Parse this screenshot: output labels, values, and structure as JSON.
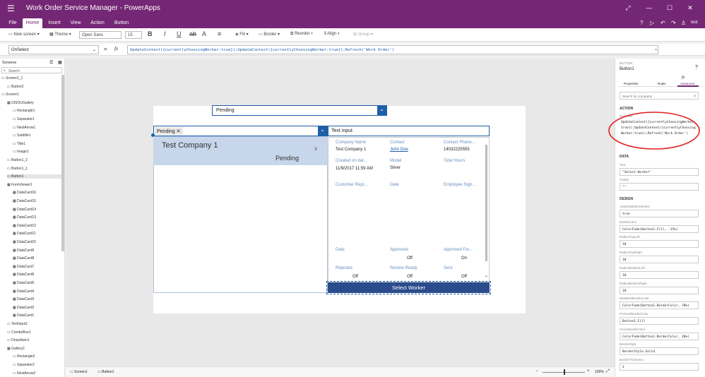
{
  "app": {
    "title": "Work Order Service Manager - PowerApps",
    "user": "test"
  },
  "tabs": [
    "File",
    "Home",
    "Insert",
    "View",
    "Action",
    "Button"
  ],
  "ribbon": {
    "new_screen": "New screen",
    "theme": "Theme",
    "font": "Open Sans",
    "font_size": "15",
    "fill": "Fill",
    "border": "Border",
    "reorder": "Reorder",
    "align": "Align",
    "group": "Group"
  },
  "formula_bar": {
    "property": "OnSelect",
    "fx": "fx",
    "formula": "UpdateContext({currentlyChoosingWorker:true});UpdateContext({currentlyChoosingWorker:true});Refresh('Work Order')"
  },
  "tree": {
    "header": "Screens",
    "search_placeholder": "Search",
    "items": [
      "Screen1_1",
      "Button2",
      "Screen1",
      "DISOUGallery",
      "Rectangle1",
      "Separator1",
      "NextArrow1",
      "Subtitle1",
      "Title1",
      "Image1",
      "Button1_2",
      "Button1_1",
      "Button1",
      "FormViewer1",
      "DataCard16",
      "DataCard15",
      "DataCard14",
      "DataCard13",
      "DataCard12",
      "DataCard11",
      "DataCard10",
      "DataCard9",
      "DataCard8",
      "DataCard7",
      "DataCard6",
      "DataCard5",
      "DataCard4",
      "DataCard3",
      "DataCard2",
      "DataCard1",
      "TextInput1",
      "ComboBox1",
      "Dropdown1",
      "Gallery2",
      "Rectangle2",
      "Separator2",
      "NextArrow2"
    ]
  },
  "canvas": {
    "dropdown_value": "Pending",
    "combo_tag": "Pending",
    "text_input": "Text input",
    "gallery": {
      "title": "Test Company 1",
      "status": "Pending"
    },
    "form": {
      "labels": {
        "company": "Company Name",
        "contact": "Contact",
        "phone": "Contact Phone...",
        "created": "Created on dat...",
        "model": "Model",
        "hours": "Total Hours",
        "customer": "Customer Repr...",
        "date1": "Date",
        "employee": "Employee Sign...",
        "date2": "Date",
        "approved": "Approved",
        "approved_for": "Approved For...",
        "rejected": "Rejected",
        "review": "Review Ready",
        "sent": "Sent"
      },
      "values": {
        "company": "Test Company 1",
        "contact": "John Doe",
        "phone": "14032225555",
        "created": "11/9/2017 11:59 AM",
        "model": "Silver",
        "approved": "Off",
        "approved_for": "On",
        "rejected": "Off",
        "review": "Off",
        "sent": "Off"
      }
    },
    "button_label": "Select Worker"
  },
  "props": {
    "kind": "BUTTON",
    "name": "Button1",
    "tabs": [
      "Properties",
      "Rules",
      "Advanced"
    ],
    "search_placeholder": "Search for a property ...",
    "section_action": "ACTION",
    "onselect_label": "OnSelect",
    "onselect_value": "UpdateContext({currentlyChoosingWorker:true});UpdateContext({currentlyChoosingWorker:true});Refresh('Work Order')",
    "section_data": "DATA",
    "text_label": "Text",
    "text_value": "\"Select Worker\"",
    "tooltip_label": "Tooltip",
    "tooltip_value": "\"\"",
    "section_design": "DESIGN",
    "design": [
      {
        "label": "AutoDisableOnSelect",
        "value": "true"
      },
      {
        "label": "BorderColor",
        "value": "ColorFade(Button1.Fill, -15%)"
      },
      {
        "label": "RadiusTopLeft",
        "value": "10"
      },
      {
        "label": "RadiusTopRight",
        "value": "10"
      },
      {
        "label": "RadiusBottomLeft",
        "value": "10"
      },
      {
        "label": "RadiusBottomRight",
        "value": "10"
      },
      {
        "label": "DisabledBorderColor",
        "value": "ColorFade(Button1.BorderColor, 70%)"
      },
      {
        "label": "PressedBorderColor",
        "value": "Button1.Fill"
      },
      {
        "label": "HoverBorderColor",
        "value": "ColorFade(Button1.BorderColor, 20%)"
      },
      {
        "label": "BorderStyle",
        "value": "BorderStyle.Solid"
      },
      {
        "label": "BorderThickness",
        "value": "2"
      }
    ]
  },
  "status": {
    "screen": "Screen1",
    "control": "Button1",
    "zoom": "100%"
  },
  "colors": {
    "brand": "#742774",
    "selected_button": "#2b4c8c",
    "annotation": "#e02020"
  }
}
